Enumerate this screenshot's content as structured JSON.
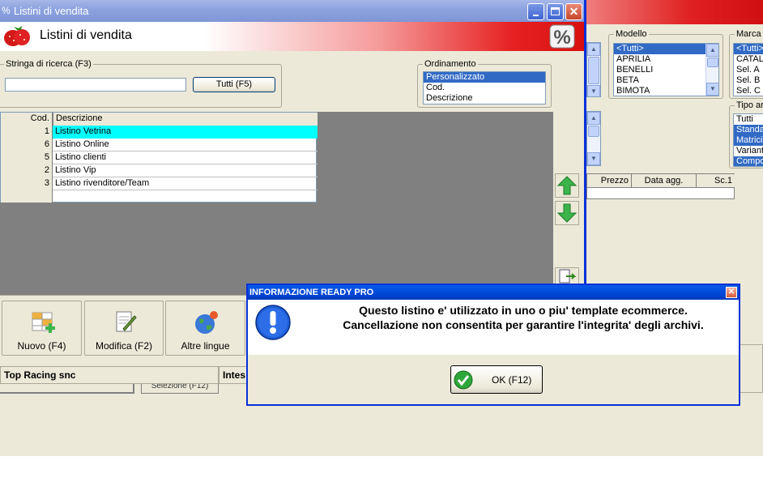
{
  "main_window": {
    "title": "Listini di vendita",
    "header_title": "Listini di vendita",
    "search": {
      "label": "Stringa di ricerca (F3)",
      "value": "",
      "all_button": "Tutti (F5)"
    },
    "ordering": {
      "label": "Ordinamento",
      "options": [
        "Personalizzato",
        "Cod.",
        "Descrizione"
      ],
      "selected": "Personalizzato"
    },
    "grid": {
      "headers": [
        "Cod.",
        "Descrizione"
      ],
      "rows": [
        {
          "cod": "1",
          "desc": "Listino Vetrina"
        },
        {
          "cod": "6",
          "desc": "Listino Online"
        },
        {
          "cod": "5",
          "desc": "Listino clienti"
        },
        {
          "cod": "2",
          "desc": "Listino Vip"
        },
        {
          "cod": "3",
          "desc": "Listino rivenditore/Team"
        }
      ]
    },
    "toolbar": {
      "new": "Nuovo (F4)",
      "edit": "Modifica (F2)",
      "lang": "Altre lingue"
    },
    "status": {
      "company": "Top Racing snc",
      "intes": "Intes"
    },
    "clipped_bottom": {
      "text": "Selezione (F12)"
    }
  },
  "background_window": {
    "modello": {
      "label": "Modello",
      "items": [
        "<Tutti>",
        "APRILIA",
        "BENELLI",
        "BETA",
        "BIMOTA"
      ]
    },
    "marca": {
      "label": "Marca",
      "items": [
        "<Tutti>",
        "CATALO",
        "Sel. A",
        "Sel. B",
        "Sel. C"
      ]
    },
    "tipo": {
      "label": "Tipo art",
      "items": [
        "Tutti",
        "Standar",
        "Matrici",
        "Varianti",
        "Compos"
      ]
    },
    "table_headers": [
      "Prezzo",
      "Data agg.",
      "Sc.1"
    ]
  },
  "dialog": {
    "title": "INFORMAZIONE READY PRO",
    "line1": "Questo listino e' utilizzato in uno o piu' template ecommerce.",
    "line2": "Cancellazione non consentita per garantire l'integrita' degli archivi.",
    "ok": "OK (F12)"
  },
  "colors": {
    "selection": "#316ac5",
    "grid_selection": "#00ffff",
    "dialog_frame": "#0831d9",
    "header_red": "#e02020"
  }
}
